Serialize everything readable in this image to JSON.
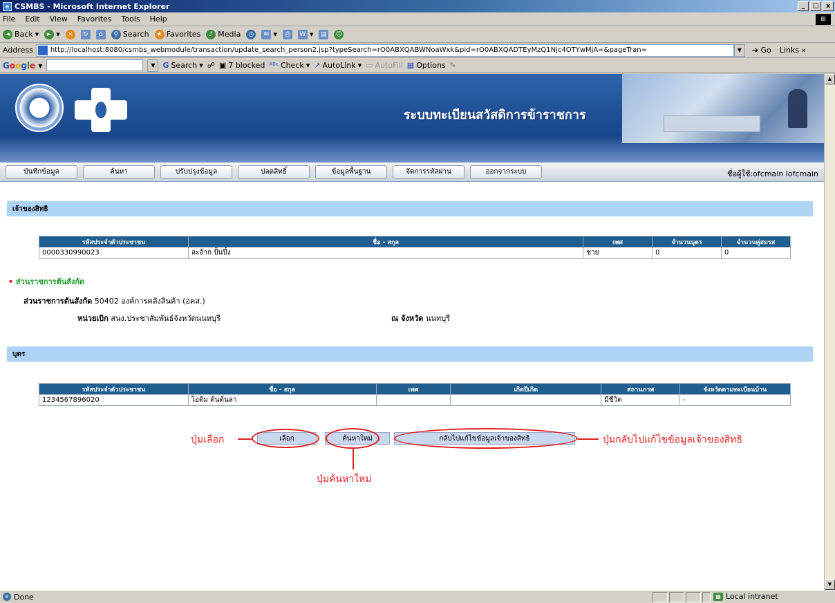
{
  "window": {
    "title": "CSMBS - Microsoft Internet Explorer",
    "buttons": {
      "minimize": "_",
      "maximize": "□",
      "close": "x"
    }
  },
  "menu": {
    "items": [
      "File",
      "Edit",
      "View",
      "Favorites",
      "Tools",
      "Help"
    ]
  },
  "toolbar": {
    "back": "Back",
    "search": "Search",
    "favorites": "Favorites",
    "media": "Media"
  },
  "address": {
    "label": "Address",
    "url": "http://localhost:8080/csmbs_webmodule/transaction/update_search_person2.jsp?typeSearch=rO0ABXQABWNoaWxk&pid=rO0ABXQADTEyMzQ1Njc4OTYwMjA=&pageTran=",
    "go": "Go",
    "links": "Links"
  },
  "googlebar": {
    "logo": "Google",
    "search": "Search",
    "blocked": "7 blocked",
    "check": "Check",
    "autolink": "AutoLink",
    "autofill": "AutoFill",
    "options": "Options"
  },
  "header": {
    "site_title": "ระบบทะเบียนสวัสดิการข้าราชการ"
  },
  "nav": {
    "items": [
      "บันทึกข้อมูล",
      "ค้นหา",
      "ปรับปรุงข้อมูล",
      "ปลดสิทธิ์",
      "ข้อมูลพื้นฐาน",
      "จัดการรหัสผ่าน",
      "ออกจากระบบ"
    ],
    "user_label": "ชื่อผู้ใช้:ofcmain lofcmain"
  },
  "owner": {
    "section_title": "เจ้าของสิทธิ",
    "columns": [
      "รหัสประจำตัวประชาชน",
      "ชื่อ - สกุล",
      "เพศ",
      "จำนวนบุตร",
      "จำนวนคู่สมรส"
    ],
    "rows": [
      [
        "0000330990023",
        "ละอ้าก ปั้นปึ๋ง",
        "ชาย",
        "0",
        "0"
      ]
    ]
  },
  "affiliation": {
    "heading": "ส่วนราชการต้นสังกัด",
    "dept_label": "ส่วนราชการต้นสังกัด",
    "dept_value": "50402 องค์การคลังสินค้า (อคส.)",
    "unit_label": "หน่วยเบิก",
    "unit_value": "สนง.ประชาสัมพันธ์จังหวัดนนทบุรี",
    "province_label": "ณ จังหวัด",
    "province_value": "นนทบุรี"
  },
  "children": {
    "section_title": "บุตร",
    "columns": [
      "รหัสประจำตัวประชาชน",
      "ชื่อ - สกุล",
      "เพศ",
      "เกิดปีเกิด",
      "สถานภาพ",
      "จังหวัดตามทะเบียนบ้าน"
    ],
    "rows": [
      [
        "1234567896020",
        "ไอติม ต้นต้นลา",
        "",
        "",
        "มีชีวิต",
        "-"
      ]
    ]
  },
  "actions": {
    "select": "เลือก",
    "new_search": "ค้นหาใหม่",
    "back_to_owner": "กลับไปแก้ไขข้อมูลเจ้าของสิทธิ"
  },
  "annotations": {
    "select": "ปุ่มเลือก",
    "new_search": "ปุ่มค้นหาใหม่",
    "back_to_owner": "ปุ่มกลับไปแก้ไขข้อมูลเจ้าของสิทธิ",
    "color": "#e02020"
  },
  "status": {
    "left": "Done",
    "zone": "Local intranet"
  }
}
